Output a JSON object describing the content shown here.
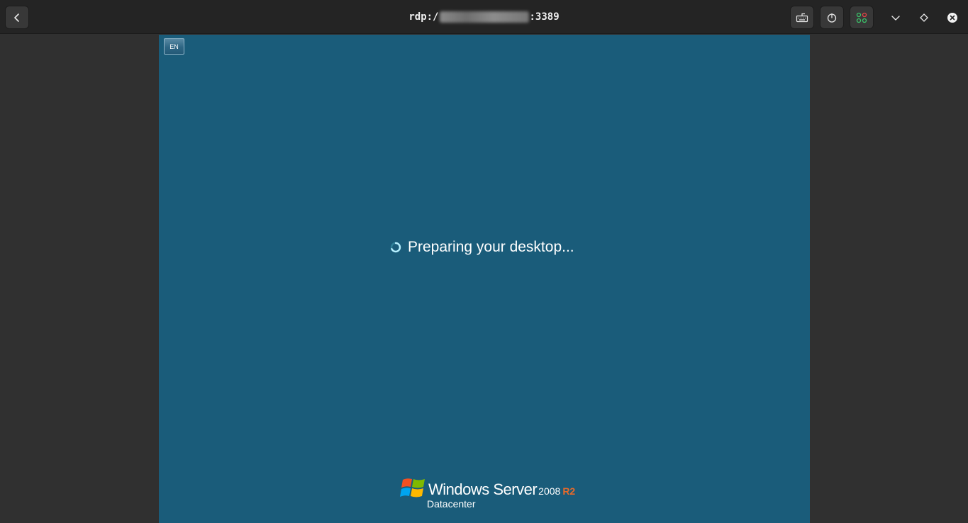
{
  "window": {
    "title_prefix": "rdp:/",
    "title_suffix": ":3389",
    "title_redacted": true
  },
  "toolbar": {
    "back_icon": "chevron-left-icon",
    "keyboard_icon": "keyboard-icon",
    "power_icon": "power-icon",
    "apps_icon": "apps-grid-icon",
    "dropdown_icon": "chevron-down-icon",
    "pin_icon": "diamond-icon",
    "close_icon": "close-icon"
  },
  "remote": {
    "background": "#1a5c7a",
    "language_indicator": "EN",
    "status_message": "Preparing your desktop...",
    "branding": {
      "product": "Windows Server",
      "version": "2008",
      "release": "R2",
      "edition": "Datacenter"
    }
  },
  "colors": {
    "titlebar": "#242424",
    "outer_background": "#303030",
    "release_accent": "#e86a2a"
  }
}
